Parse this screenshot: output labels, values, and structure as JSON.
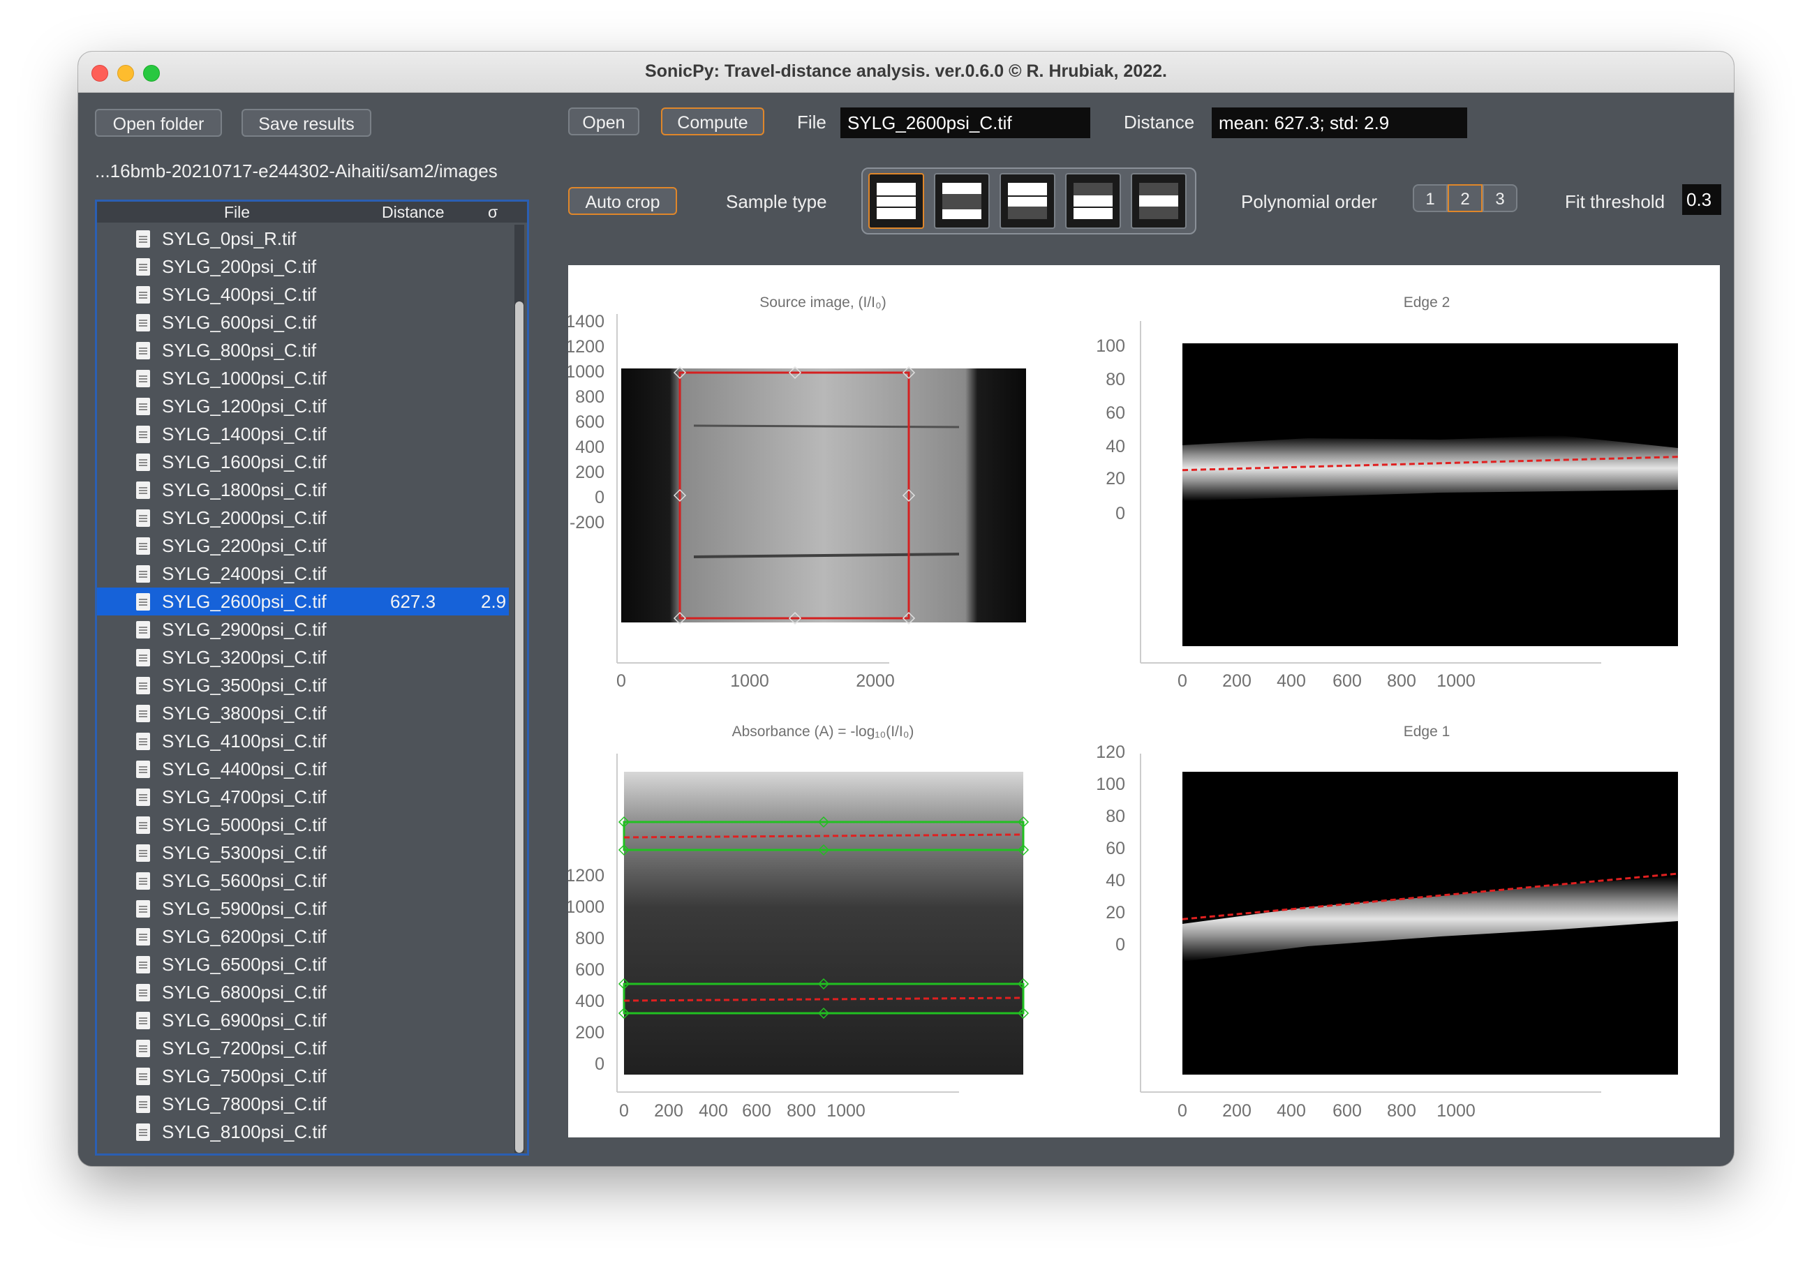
{
  "window": {
    "title": "SonicPy: Travel-distance analysis. ver.0.6.0  © R. Hrubiak, 2022."
  },
  "left": {
    "open_folder": "Open folder",
    "save_results": "Save results",
    "path": "...16bmb-20210717-e244302-Aihaiti/sam2/images",
    "columns": {
      "file": "File",
      "distance": "Distance",
      "sigma": "σ"
    },
    "files": [
      {
        "name": "SYLG_0psi_R.tif",
        "distance": "",
        "sigma": ""
      },
      {
        "name": "SYLG_200psi_C.tif",
        "distance": "",
        "sigma": ""
      },
      {
        "name": "SYLG_400psi_C.tif",
        "distance": "",
        "sigma": ""
      },
      {
        "name": "SYLG_600psi_C.tif",
        "distance": "",
        "sigma": ""
      },
      {
        "name": "SYLG_800psi_C.tif",
        "distance": "",
        "sigma": ""
      },
      {
        "name": "SYLG_1000psi_C.tif",
        "distance": "",
        "sigma": ""
      },
      {
        "name": "SYLG_1200psi_C.tif",
        "distance": "",
        "sigma": ""
      },
      {
        "name": "SYLG_1400psi_C.tif",
        "distance": "",
        "sigma": ""
      },
      {
        "name": "SYLG_1600psi_C.tif",
        "distance": "",
        "sigma": ""
      },
      {
        "name": "SYLG_1800psi_C.tif",
        "distance": "",
        "sigma": ""
      },
      {
        "name": "SYLG_2000psi_C.tif",
        "distance": "",
        "sigma": ""
      },
      {
        "name": "SYLG_2200psi_C.tif",
        "distance": "",
        "sigma": ""
      },
      {
        "name": "SYLG_2400psi_C.tif",
        "distance": "",
        "sigma": ""
      },
      {
        "name": "SYLG_2600psi_C.tif",
        "distance": "627.3",
        "sigma": "2.9",
        "selected": true
      },
      {
        "name": "SYLG_2900psi_C.tif",
        "distance": "",
        "sigma": ""
      },
      {
        "name": "SYLG_3200psi_C.tif",
        "distance": "",
        "sigma": ""
      },
      {
        "name": "SYLG_3500psi_C.tif",
        "distance": "",
        "sigma": ""
      },
      {
        "name": "SYLG_3800psi_C.tif",
        "distance": "",
        "sigma": ""
      },
      {
        "name": "SYLG_4100psi_C.tif",
        "distance": "",
        "sigma": ""
      },
      {
        "name": "SYLG_4400psi_C.tif",
        "distance": "",
        "sigma": ""
      },
      {
        "name": "SYLG_4700psi_C.tif",
        "distance": "",
        "sigma": ""
      },
      {
        "name": "SYLG_5000psi_C.tif",
        "distance": "",
        "sigma": ""
      },
      {
        "name": "SYLG_5300psi_C.tif",
        "distance": "",
        "sigma": ""
      },
      {
        "name": "SYLG_5600psi_C.tif",
        "distance": "",
        "sigma": ""
      },
      {
        "name": "SYLG_5900psi_C.tif",
        "distance": "",
        "sigma": ""
      },
      {
        "name": "SYLG_6200psi_C.tif",
        "distance": "",
        "sigma": ""
      },
      {
        "name": "SYLG_6500psi_C.tif",
        "distance": "",
        "sigma": ""
      },
      {
        "name": "SYLG_6800psi_C.tif",
        "distance": "",
        "sigma": ""
      },
      {
        "name": "SYLG_6900psi_C.tif",
        "distance": "",
        "sigma": ""
      },
      {
        "name": "SYLG_7200psi_C.tif",
        "distance": "",
        "sigma": ""
      },
      {
        "name": "SYLG_7500psi_C.tif",
        "distance": "",
        "sigma": ""
      },
      {
        "name": "SYLG_7800psi_C.tif",
        "distance": "",
        "sigma": ""
      },
      {
        "name": "SYLG_8100psi_C.tif",
        "distance": "",
        "sigma": ""
      }
    ]
  },
  "toolbar": {
    "open": "Open",
    "compute": "Compute",
    "file_label": "File",
    "file_value": "SYLG_2600psi_C.tif",
    "distance_label": "Distance",
    "distance_value": "mean: 627.3; std: 2.9",
    "auto_crop": "Auto crop",
    "sample_type_label": "Sample type",
    "polynomial_label": "Polynomial order",
    "poly_options": [
      "1",
      "2",
      "3"
    ],
    "poly_selected": "2",
    "fit_threshold_label": "Fit threshold",
    "fit_threshold_value": "0.3"
  },
  "chart_data": [
    {
      "type": "heatmap",
      "title": "Source image, (I/I₀)",
      "y_ticks": [
        "1400",
        "1200",
        "1000",
        "800",
        "600",
        "400",
        "200",
        "0",
        "-200"
      ],
      "x_ticks": [
        "0",
        "1000",
        "2000"
      ],
      "roi_color": "#d42020"
    },
    {
      "type": "heatmap",
      "title": "Edge 2",
      "y_ticks": [
        "100",
        "80",
        "60",
        "40",
        "20",
        "0"
      ],
      "x_ticks": [
        "0",
        "200",
        "400",
        "600",
        "800",
        "1000"
      ],
      "fit_line": {
        "x": [
          0,
          1080
        ],
        "y": [
          59.5,
          64
        ]
      }
    },
    {
      "type": "heatmap",
      "title": "Absorbance (A) = -log₁₀(I/I₀)",
      "y_ticks": [
        "1200",
        "1000",
        "800",
        "600",
        "400",
        "200",
        "0"
      ],
      "x_ticks": [
        "0",
        "200",
        "400",
        "600",
        "800",
        "1000"
      ],
      "fit_lines": [
        {
          "y": [
            915,
            925
          ]
        },
        {
          "y": [
            290,
            300
          ]
        }
      ]
    },
    {
      "type": "heatmap",
      "title": "Edge 1",
      "y_ticks": [
        "120",
        "100",
        "80",
        "60",
        "40",
        "20",
        "0"
      ],
      "x_ticks": [
        "0",
        "200",
        "400",
        "600",
        "800",
        "1000"
      ],
      "fit_line": {
        "x": [
          0,
          1080
        ],
        "y": [
          49.5,
          64
        ]
      }
    }
  ],
  "colors": {
    "accent_orange": "#e0872a",
    "selection_blue": "#1662d9",
    "fit_red": "#e02020",
    "roi_green": "#21c021"
  }
}
